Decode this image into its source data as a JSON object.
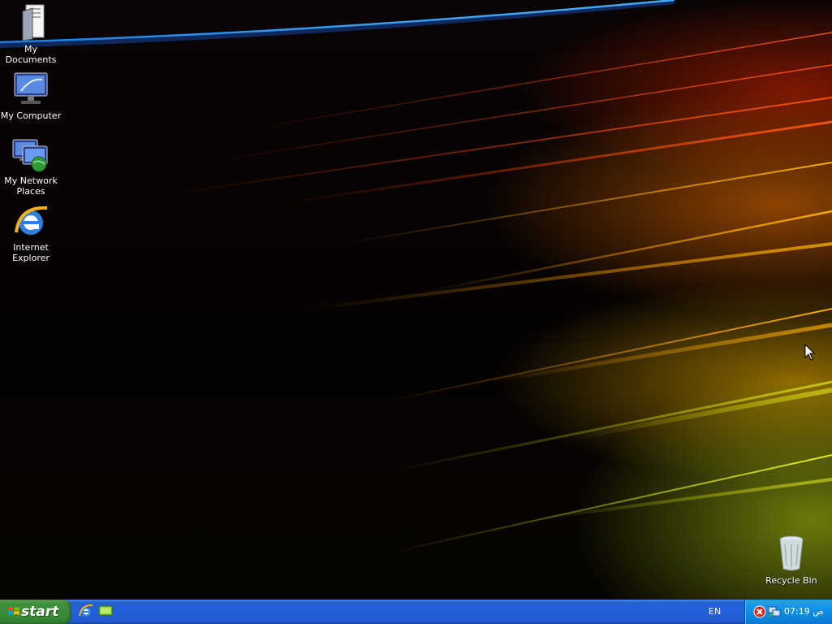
{
  "desktop": {
    "icons": [
      {
        "label": "My Documents",
        "icon": "folder-documents-icon"
      },
      {
        "label": "My Computer",
        "icon": "computer-icon"
      },
      {
        "label": "My Network\nPlaces",
        "icon": "network-icon"
      },
      {
        "label": "Internet\nExplorer",
        "icon": "ie-icon"
      },
      {
        "label": "Recycle Bin",
        "icon": "recycle-bin-icon"
      }
    ]
  },
  "taskbar": {
    "start_label": "start",
    "quicklaunch": [
      {
        "icon": "ie-icon"
      },
      {
        "icon": "show-desktop-icon"
      }
    ],
    "language": "EN",
    "clock": "07:19 ص"
  },
  "colors": {
    "taskbar_blue": "#245edb",
    "start_green": "#3c8f3a",
    "tray_blue": "#0f8de3"
  }
}
